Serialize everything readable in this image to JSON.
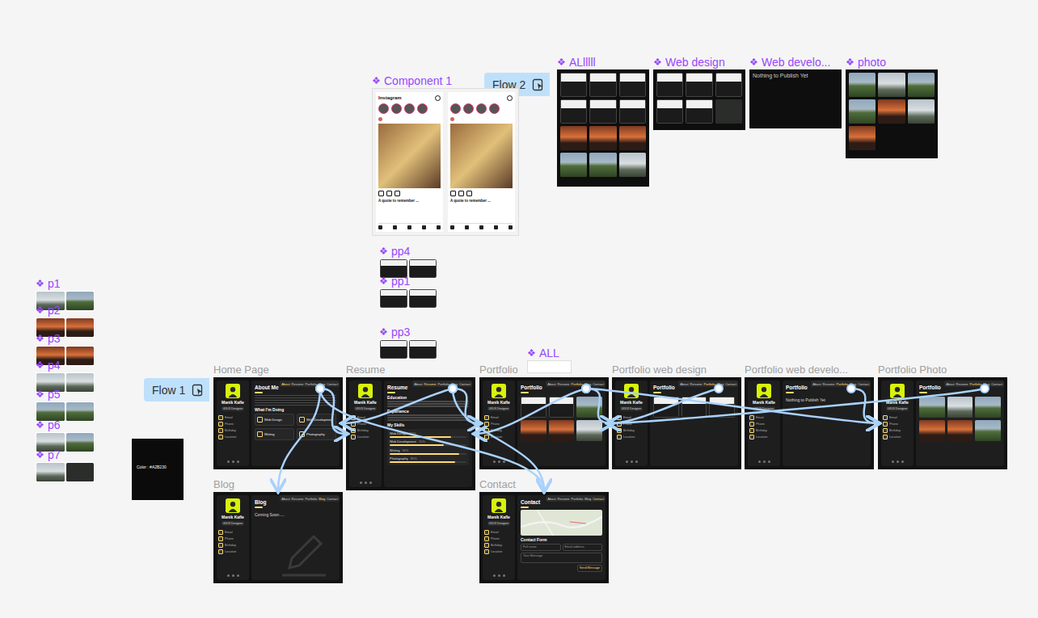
{
  "page": {
    "component_mark": "❖"
  },
  "flows": [
    {
      "label": "Flow 1"
    },
    {
      "label": "Flow 2"
    }
  ],
  "profile": {
    "name": "Manik Kafle",
    "role": "UI/UX Designer",
    "contacts": [
      "Email",
      "Phone",
      "Birthday",
      "Location"
    ]
  },
  "frames": [
    {
      "title": "Home Page",
      "kind": "about",
      "heading": "About Me",
      "section": "What I'm Doing",
      "cards": [
        "Web Design",
        "Web Development",
        "Writing",
        "Photography"
      ],
      "tabs": [
        {
          "label": "About",
          "selected": true
        },
        {
          "label": "Resume",
          "selected": false
        },
        {
          "label": "Portfolio",
          "selected": false
        },
        {
          "label": "Blog",
          "selected": false
        },
        {
          "label": "Contact",
          "selected": false
        }
      ]
    },
    {
      "title": "Resume",
      "kind": "resume",
      "heading": "Resume",
      "sections": [
        "Education",
        "Experience"
      ],
      "skills_title": "My Skills",
      "skills": [
        {
          "label": "Web Design",
          "reading": "80%",
          "level": 0.8
        },
        {
          "label": "Web Development",
          "reading": "70%",
          "level": 0.7
        },
        {
          "label": "Writing",
          "reading": "90%",
          "level": 0.9
        },
        {
          "label": "Photography",
          "reading": "85%",
          "level": 0.85
        }
      ],
      "tabs": [
        {
          "label": "About",
          "selected": false
        },
        {
          "label": "Resume",
          "selected": true
        },
        {
          "label": "Portfolio",
          "selected": false
        },
        {
          "label": "Blog",
          "selected": false
        },
        {
          "label": "Contact",
          "selected": false
        }
      ]
    },
    {
      "title": "Portfolio",
      "kind": "gallery",
      "heading": "Portfolio",
      "tiles": [
        {
          "kind": "site"
        },
        {
          "kind": "site"
        },
        {
          "kind": "green"
        },
        {
          "kind": "sunset"
        },
        {
          "kind": "sunset"
        },
        {
          "kind": "mist"
        }
      ],
      "tabs": [
        {
          "label": "About",
          "selected": false
        },
        {
          "label": "Resume",
          "selected": false
        },
        {
          "label": "Portfolio",
          "selected": true
        },
        {
          "label": "Blog",
          "selected": false
        },
        {
          "label": "Contact",
          "selected": false
        }
      ]
    },
    {
      "title": "Portfolio web design",
      "kind": "gallery",
      "heading": "Portfolio",
      "tiles": [
        {
          "kind": "site"
        },
        {
          "kind": "site"
        },
        {
          "kind": "site"
        }
      ],
      "tabs": [
        {
          "label": "About",
          "selected": false
        },
        {
          "label": "Resume",
          "selected": false
        },
        {
          "label": "Portfolio",
          "selected": true
        },
        {
          "label": "Blog",
          "selected": false
        },
        {
          "label": "Contact",
          "selected": false
        }
      ]
    },
    {
      "title": "Portfolio web develo...",
      "kind": "empty",
      "heading": "Portfolio",
      "message": "Nothing to Publish Yet",
      "tabs": [
        {
          "label": "About",
          "selected": false
        },
        {
          "label": "Resume",
          "selected": false
        },
        {
          "label": "Portfolio",
          "selected": true
        },
        {
          "label": "Blog",
          "selected": false
        },
        {
          "label": "Contact",
          "selected": false
        }
      ]
    },
    {
      "title": "Portfolio Photo",
      "kind": "gallery",
      "heading": "Portfolio",
      "tiles": [
        {
          "kind": "green"
        },
        {
          "kind": "mist"
        },
        {
          "kind": "green"
        },
        {
          "kind": "sunset"
        },
        {
          "kind": "sunset"
        },
        {
          "kind": "green"
        }
      ],
      "tabs": [
        {
          "label": "About",
          "selected": false
        },
        {
          "label": "Resume",
          "selected": false
        },
        {
          "label": "Portfolio",
          "selected": true
        },
        {
          "label": "Blog",
          "selected": false
        },
        {
          "label": "Contact",
          "selected": false
        }
      ]
    },
    {
      "title": "Blog",
      "kind": "blog",
      "heading": "Blog",
      "message": "Coming Soon.....",
      "tabs": [
        {
          "label": "About",
          "selected": false
        },
        {
          "label": "Resume",
          "selected": false
        },
        {
          "label": "Portfolio",
          "selected": false
        },
        {
          "label": "Blog",
          "selected": true
        },
        {
          "label": "Contact",
          "selected": false
        }
      ]
    },
    {
      "title": "Contact",
      "kind": "contact",
      "heading": "Contact",
      "form_title": "Contact Form",
      "fields": [
        "Full name",
        "Email address",
        "Your Message"
      ],
      "button": "Send Message",
      "tabs": [
        {
          "label": "About",
          "selected": false
        },
        {
          "label": "Resume",
          "selected": false
        },
        {
          "label": "Portfolio",
          "selected": false
        },
        {
          "label": "Blog",
          "selected": false
        },
        {
          "label": "Contact",
          "selected": true
        }
      ]
    }
  ],
  "components": [
    {
      "label": "Component 1",
      "kind": "instagram",
      "screens": [
        {
          "app": "Instagram",
          "caption": "A quote to remember ..."
        },
        {
          "app": "",
          "caption": "A quote to remember ..."
        }
      ]
    },
    {
      "label": "ALlllll",
      "kind": "grid",
      "tiles": [
        {
          "kind": "site"
        },
        {
          "kind": "site"
        },
        {
          "kind": "site"
        },
        {
          "kind": "site"
        },
        {
          "kind": "site"
        },
        {
          "kind": "site"
        },
        {
          "kind": "sunset"
        },
        {
          "kind": "sunset"
        },
        {
          "kind": "sunset"
        },
        {
          "kind": "green"
        },
        {
          "kind": "green"
        },
        {
          "kind": "mist"
        }
      ]
    },
    {
      "label": "Web design",
      "kind": "grid",
      "tiles": [
        {
          "kind": "site"
        },
        {
          "kind": "site"
        },
        {
          "kind": "site"
        },
        {
          "kind": "site"
        },
        {
          "kind": "site"
        },
        {
          "kind": "dark"
        }
      ]
    },
    {
      "label": "Web develo...",
      "kind": "empty",
      "message": "Nothing to Publish Yet"
    },
    {
      "label": "photo",
      "kind": "grid",
      "tiles": [
        {
          "kind": "green"
        },
        {
          "kind": "mist"
        },
        {
          "kind": "green"
        },
        {
          "kind": "green"
        },
        {
          "kind": "sunset"
        },
        {
          "kind": "mist"
        },
        {
          "kind": "sunset"
        }
      ]
    },
    {
      "label": "ALL",
      "kind": "bar"
    },
    {
      "label": "pp4",
      "kind": "pair",
      "tiles": [
        {
          "kind": "site"
        },
        {
          "kind": "site"
        }
      ]
    },
    {
      "label": "pp1",
      "kind": "pair",
      "tiles": [
        {
          "kind": "site"
        },
        {
          "kind": "site"
        }
      ]
    },
    {
      "label": "pp3",
      "kind": "pair",
      "tiles": [
        {
          "kind": "site"
        },
        {
          "kind": "site"
        }
      ]
    },
    {
      "label": "p1",
      "kind": "pair",
      "tiles": [
        {
          "kind": "mist"
        },
        {
          "kind": "green"
        }
      ]
    },
    {
      "label": "p2",
      "kind": "pair",
      "tiles": [
        {
          "kind": "sunset"
        },
        {
          "kind": "sunset"
        }
      ]
    },
    {
      "label": "p3",
      "kind": "pair",
      "tiles": [
        {
          "kind": "sunset"
        },
        {
          "kind": "sunset"
        }
      ]
    },
    {
      "label": "p4",
      "kind": "pair",
      "tiles": [
        {
          "kind": "mist"
        },
        {
          "kind": "mist"
        }
      ]
    },
    {
      "label": "p5",
      "kind": "pair",
      "tiles": [
        {
          "kind": "green"
        },
        {
          "kind": "green"
        }
      ]
    },
    {
      "label": "p6",
      "kind": "pair",
      "tiles": [
        {
          "kind": "mist"
        },
        {
          "kind": "green"
        }
      ]
    },
    {
      "label": "p7",
      "kind": "pair",
      "tiles": [
        {
          "kind": "mist"
        },
        {
          "kind": "dark"
        }
      ]
    },
    {
      "label": "",
      "kind": "swatch",
      "text": "Color : #A2B230"
    }
  ],
  "connections": [
    {
      "from": "Home Page",
      "to": "Resume"
    },
    {
      "from": "Home Page",
      "to": "Blog"
    },
    {
      "from": "Home Page",
      "to": "Contact"
    },
    {
      "from": "Resume",
      "to": "Home Page"
    },
    {
      "from": "Resume",
      "to": "Portfolio"
    },
    {
      "from": "Resume",
      "to": "Contact"
    },
    {
      "from": "Portfolio",
      "to": "Resume"
    },
    {
      "from": "Portfolio",
      "to": "Portfolio web design"
    },
    {
      "from": "Portfolio",
      "to": "Portfolio Photo"
    },
    {
      "from": "Portfolio web design",
      "to": "Portfolio"
    },
    {
      "from": "Portfolio web develo...",
      "to": "Portfolio Photo"
    },
    {
      "from": "Portfolio Photo",
      "to": "Portfolio"
    }
  ]
}
